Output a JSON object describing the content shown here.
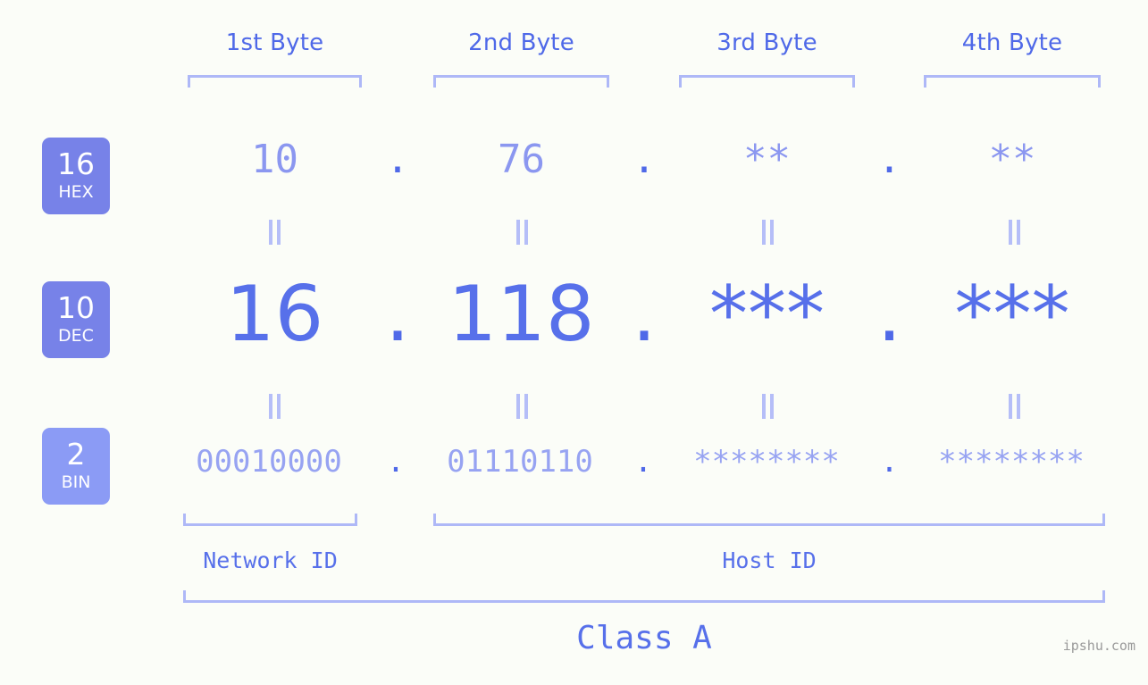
{
  "page": {
    "background_color": "#fbfdf8",
    "accent_color": "#5770ea",
    "muted_accent_color": "#aeb8f7",
    "badge_color": "#7782e8",
    "badge_color_light": "#8b9bf5",
    "watermark": "ipshu.com"
  },
  "byte_headers": [
    {
      "label": "1st Byte"
    },
    {
      "label": "2nd Byte"
    },
    {
      "label": "3rd Byte"
    },
    {
      "label": "4th Byte"
    }
  ],
  "rows": [
    {
      "badge_number": "16",
      "badge_name": "HEX",
      "values": [
        "10",
        "76",
        "**",
        "**"
      ],
      "separators": [
        ".",
        ".",
        "."
      ]
    },
    {
      "badge_number": "10",
      "badge_name": "DEC",
      "values": [
        "16",
        "118",
        "***",
        "***"
      ],
      "separators": [
        ".",
        ".",
        "."
      ]
    },
    {
      "badge_number": "2",
      "badge_name": "BIN",
      "values": [
        "00010000",
        "01110110",
        "********",
        "********"
      ],
      "separators": [
        ".",
        ".",
        "."
      ]
    }
  ],
  "equality_markers": {
    "symbol": "=",
    "count_per_gap": 4
  },
  "id_sections": [
    {
      "label": "Network ID"
    },
    {
      "label": "Host ID"
    }
  ],
  "class_section": {
    "label": "Class A"
  }
}
